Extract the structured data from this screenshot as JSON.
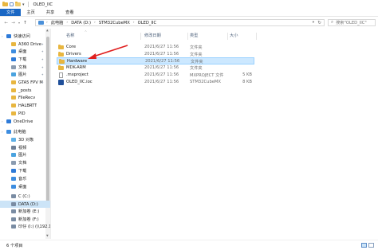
{
  "window": {
    "title": "OLED_IIC"
  },
  "ribbon": {
    "tabs": [
      "文件",
      "主页",
      "共享",
      "查看"
    ]
  },
  "nav": {
    "breadcrumbs": [
      "此电脑",
      "DATA (D:)",
      "STM32CubeMX",
      "OLED_IIC"
    ],
    "search_placeholder": "搜索\"OLED_IIC\""
  },
  "columns": {
    "name": "名称",
    "date": "修改日期",
    "type": "类型",
    "size": "大小"
  },
  "files": [
    {
      "name": "Core",
      "date": "2021/6/27 11:56",
      "type": "文件夹",
      "size": "",
      "icon": "folder"
    },
    {
      "name": "Drivers",
      "date": "2021/6/27 11:56",
      "type": "文件夹",
      "size": "",
      "icon": "folder"
    },
    {
      "name": "Hardware",
      "date": "2021/6/27 11:56",
      "type": "文件夹",
      "size": "",
      "icon": "folder"
    },
    {
      "name": "MDK-ARM",
      "date": "2021/6/27 11:56",
      "type": "文件夹",
      "size": "",
      "icon": "folder"
    },
    {
      "name": ".mxproject",
      "date": "2021/6/27 11:56",
      "type": "MXPROJECT 文件",
      "size": "5 KB",
      "icon": "file"
    },
    {
      "name": "OLED_IIC.ioc",
      "date": "2021/6/27 11:56",
      "type": "STM32CubeMX",
      "size": "8 KB",
      "icon": "stm32cubemx"
    }
  ],
  "sidebar": {
    "items": [
      {
        "label": "快速访问",
        "icon": "star-icon",
        "color": "#2f7bd8"
      },
      {
        "label": "A360 Drive",
        "icon": "folder-icon",
        "color": "#e8b640"
      },
      {
        "label": "桌面",
        "icon": "desktop-icon",
        "color": "#3d8de0"
      },
      {
        "label": "下载",
        "icon": "download-icon",
        "color": "#2f7bd8"
      },
      {
        "label": "文档",
        "icon": "documents-icon",
        "color": "#8a9bb0"
      },
      {
        "label": "图片",
        "icon": "pictures-icon",
        "color": "#4aa3df"
      },
      {
        "label": "GTA5 FPV M",
        "icon": "folder-icon",
        "color": "#e8b640"
      },
      {
        "label": "_posts",
        "icon": "folder-icon",
        "color": "#e8b640"
      },
      {
        "label": "FileRecv",
        "icon": "folder-icon",
        "color": "#e8b640"
      },
      {
        "label": "HALBRTT",
        "icon": "folder-icon",
        "color": "#e8b640"
      },
      {
        "label": "PID",
        "icon": "folder-icon",
        "color": "#e8b640"
      },
      {
        "label": "OneDrive",
        "icon": "cloud-icon",
        "color": "#2f7bd8"
      },
      {
        "label": "此电脑",
        "icon": "pc-icon",
        "color": "#3d8de0"
      },
      {
        "label": "3D 对象",
        "icon": "cube-icon",
        "color": "#5fb0e6"
      },
      {
        "label": "视频",
        "icon": "video-icon",
        "color": "#6d7f96"
      },
      {
        "label": "图片",
        "icon": "pictures-icon",
        "color": "#4aa3df"
      },
      {
        "label": "文档",
        "icon": "documents-icon",
        "color": "#8a9bb0"
      },
      {
        "label": "下载",
        "icon": "download-icon",
        "color": "#2f7bd8"
      },
      {
        "label": "音乐",
        "icon": "music-icon",
        "color": "#3d8de0"
      },
      {
        "label": "桌面",
        "icon": "desktop-icon",
        "color": "#3d8de0"
      },
      {
        "label": "C (C:)",
        "icon": "drive-icon",
        "color": "#7a8ca3"
      },
      {
        "label": "DATA (D:)",
        "icon": "drive-icon",
        "color": "#7a8ca3"
      },
      {
        "label": "新加卷 (E:)",
        "icon": "drive-icon",
        "color": "#7a8ca3"
      },
      {
        "label": "新加卷 (F:)",
        "icon": "drive-icon",
        "color": "#7a8ca3"
      },
      {
        "label": "印仔 (I:) (\\\\192.1",
        "icon": "network-drive-icon",
        "color": "#7a8ca3"
      }
    ],
    "selected": "DATA (D:)"
  },
  "status": {
    "count": "6 个项目"
  },
  "colors": {
    "accent": "#1a67c4",
    "selection": "#cce8ff",
    "annotation_arrow": "#e02020"
  }
}
